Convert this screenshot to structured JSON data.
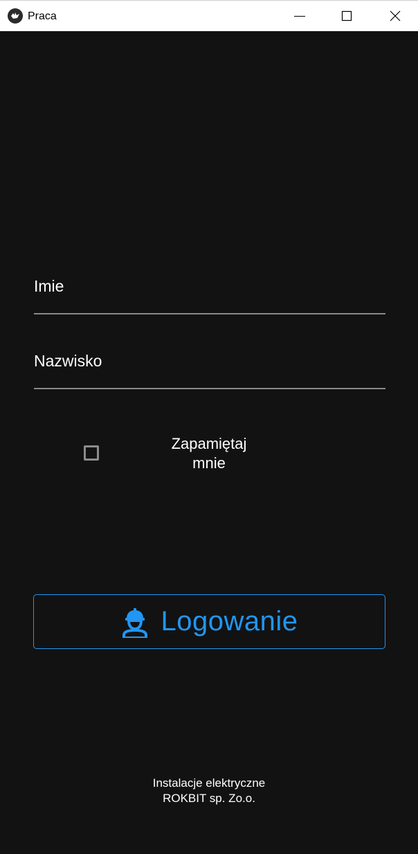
{
  "window": {
    "title": "Praca",
    "app_icon": "kivy-logo-icon",
    "controls": [
      "minimize-icon",
      "maximize-icon",
      "close-icon"
    ]
  },
  "form": {
    "first_name": {
      "label": "Imie",
      "value": ""
    },
    "last_name": {
      "label": "Nazwisko",
      "value": ""
    },
    "remember": {
      "label_line1": "Zapamiętaj",
      "label_line2": "mnie",
      "checked": false
    }
  },
  "login_button": {
    "label": "Logowanie",
    "icon": "worker-icon",
    "color": "#2196f3"
  },
  "footer": {
    "line1": "Instalacje elektryczne",
    "line2": "ROKBIT sp. Zo.o."
  },
  "colors": {
    "background": "#121212",
    "accent": "#2196f3",
    "underline": "#8a8a8a"
  }
}
